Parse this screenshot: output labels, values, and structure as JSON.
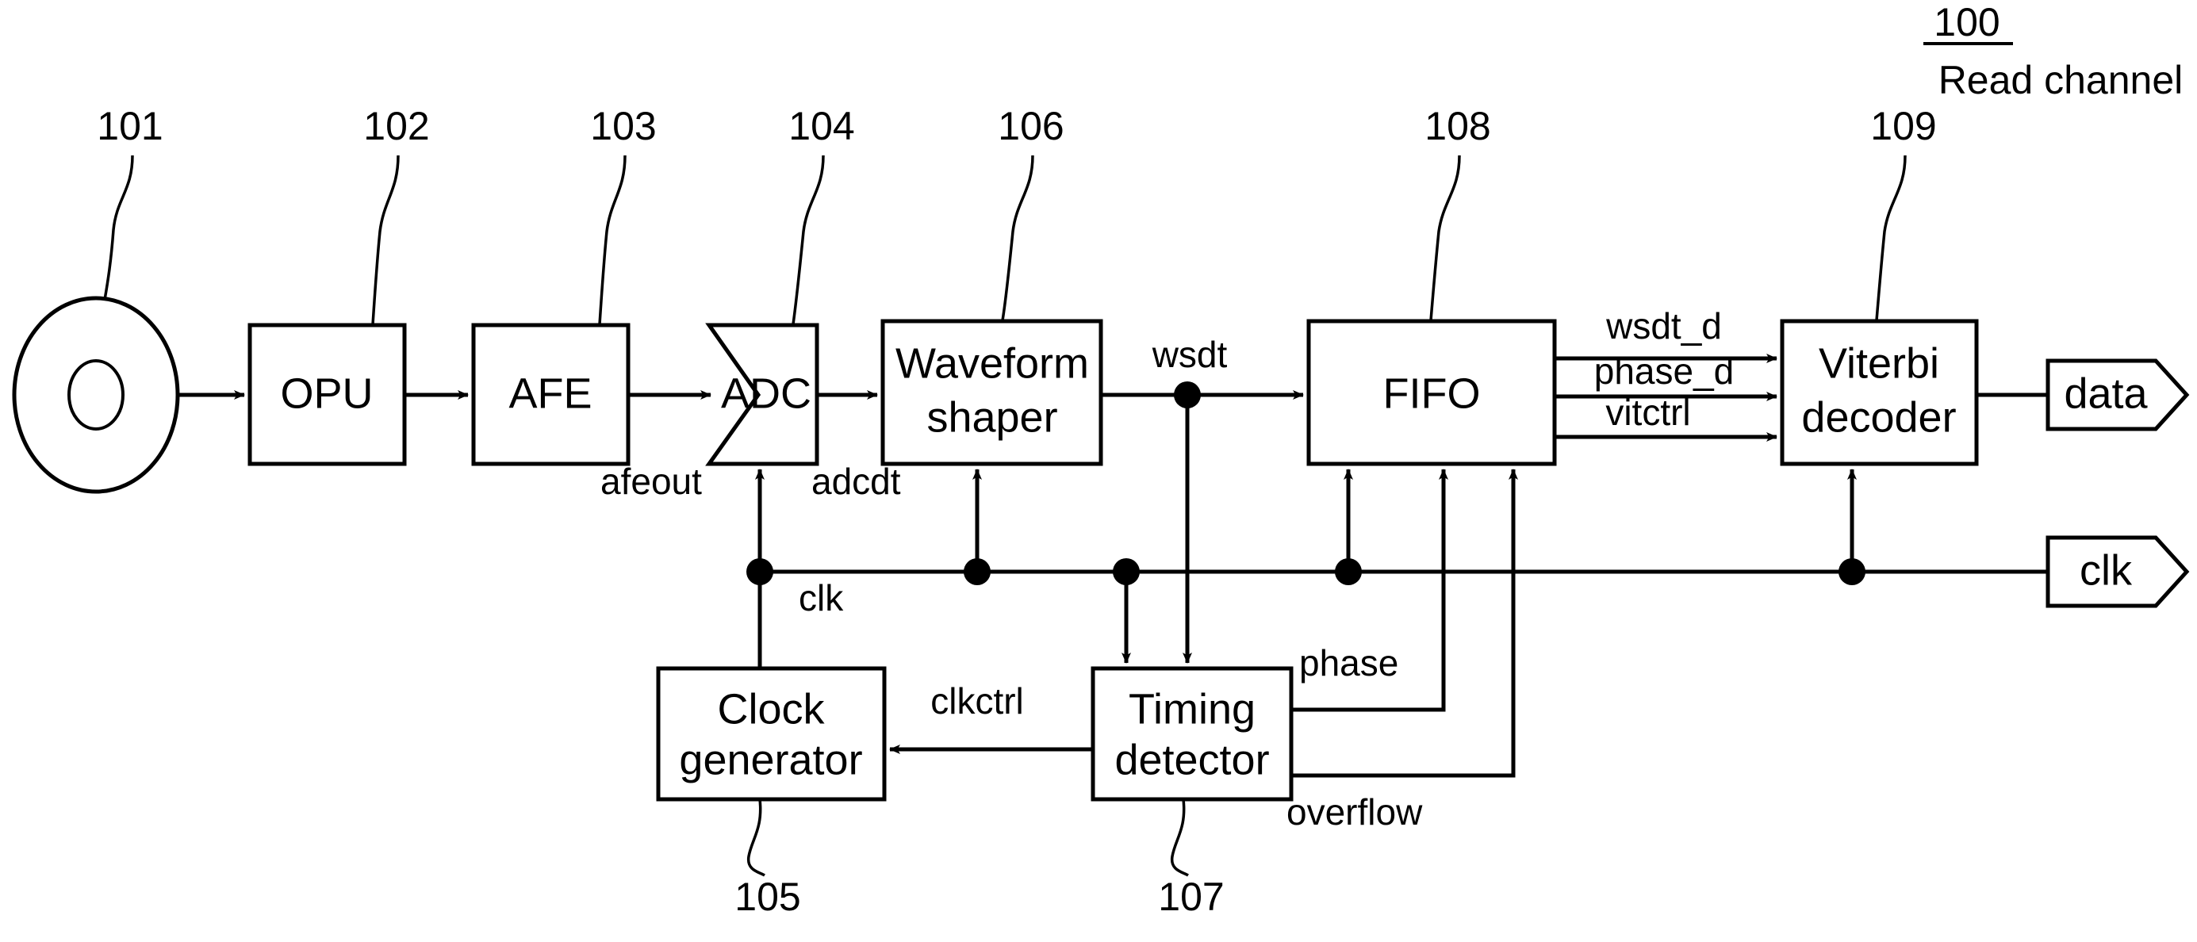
{
  "figure": {
    "reference_number": "100",
    "title": "Read channel"
  },
  "blocks": [
    {
      "id": "disc",
      "label": "",
      "ref": "101",
      "shape": "disc"
    },
    {
      "id": "opu",
      "label": "OPU",
      "ref": "102",
      "shape": "rect"
    },
    {
      "id": "afe",
      "label": "AFE",
      "ref": "103",
      "shape": "rect"
    },
    {
      "id": "adc",
      "label": "ADC",
      "ref": "104",
      "shape": "pentagon-notched"
    },
    {
      "id": "wfs",
      "label_line1": "Waveform",
      "label_line2": "shaper",
      "ref": "106",
      "shape": "rect"
    },
    {
      "id": "clkgen",
      "label_line1": "Clock",
      "label_line2": "generator",
      "ref": "105",
      "shape": "rect"
    },
    {
      "id": "timedet",
      "label_line1": "Timing",
      "label_line2": "detector",
      "ref": "107",
      "shape": "rect"
    },
    {
      "id": "fifo",
      "label": "FIFO",
      "ref": "108",
      "shape": "rect"
    },
    {
      "id": "viterbi",
      "label_line1": "Viterbi",
      "label_line2": "decoder",
      "ref": "109",
      "shape": "rect"
    }
  ],
  "ports": [
    {
      "id": "data",
      "label": "data"
    },
    {
      "id": "clk",
      "label": "clk"
    }
  ],
  "signals": [
    {
      "id": "afeout",
      "label": "afeout"
    },
    {
      "id": "adcdt",
      "label": "adcdt"
    },
    {
      "id": "wsdt",
      "label": "wsdt"
    },
    {
      "id": "clk_bus",
      "label": "clk"
    },
    {
      "id": "clkctrl",
      "label": "clkctrl"
    },
    {
      "id": "phase",
      "label": "phase"
    },
    {
      "id": "overflow",
      "label": "overflow"
    },
    {
      "id": "wsdt_d",
      "label": "wsdt_d"
    },
    {
      "id": "phase_d",
      "label": "phase_d"
    },
    {
      "id": "vitctrl",
      "label": "vitctrl"
    }
  ],
  "colors": {
    "ink": "#000000",
    "paper": "#ffffff"
  }
}
